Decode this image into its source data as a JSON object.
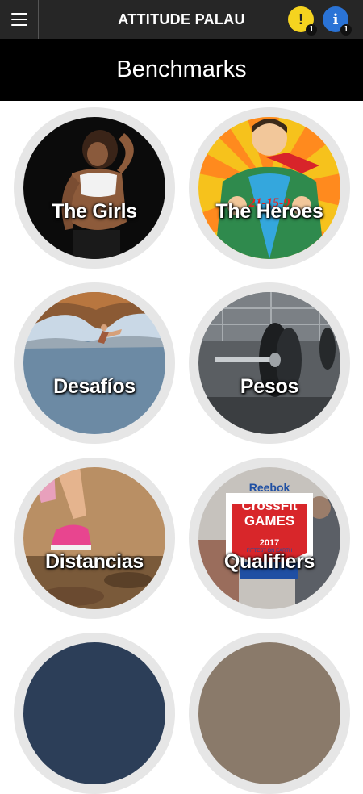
{
  "app_bar": {
    "title": "ATTITUDE PALAU",
    "menu_icon": "hamburger-menu-icon",
    "alert": {
      "glyph": "!",
      "badge": "1",
      "color": "#f5d31f"
    },
    "info": {
      "glyph": "i",
      "badge": "1",
      "color": "#2a73d6"
    }
  },
  "page": {
    "title": "Benchmarks"
  },
  "tiles": [
    {
      "label": "The Girls"
    },
    {
      "label": "The Heroes",
      "overlay_text": "21-15-9"
    },
    {
      "label": "Desafíos"
    },
    {
      "label": "Pesos"
    },
    {
      "label": "Distancias"
    },
    {
      "label": "Qualifiers",
      "logo": {
        "brand": "Reebok",
        "line1": "CrossFit",
        "line2": "GAMES",
        "year": "2017",
        "tagline": "FITTEST ON EARTH"
      }
    }
  ]
}
